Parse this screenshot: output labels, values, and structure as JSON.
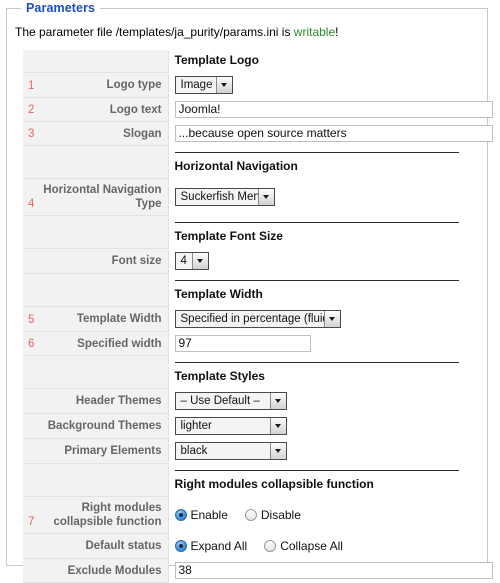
{
  "panel": {
    "legend": "Parameters",
    "intro_prefix": "The parameter file /templates/ja_purity/params.ini is ",
    "intro_status": "writable",
    "intro_suffix": "!",
    "status_color": "#2e8b30",
    "legend_color": "#1a4fc4",
    "number_color": "#e2695a"
  },
  "sections": {
    "logo": "Template Logo",
    "horizontal_nav": "Horizontal Navigation",
    "font_size": "Template Font Size",
    "template_width": "Template Width",
    "template_styles": "Template Styles",
    "right_modules": "Right modules collapsible function"
  },
  "rows": {
    "logo_type": {
      "num": "1",
      "label": "Logo type",
      "value": "Image"
    },
    "logo_text": {
      "num": "2",
      "label": "Logo text",
      "value": "Joomla!"
    },
    "slogan": {
      "num": "3",
      "label": "Slogan",
      "value": "...because open source matters"
    },
    "horizontal_nav_type": {
      "num": "4",
      "label": "Horizontal Navigation Type",
      "value": "Suckerfish Menu"
    },
    "font_size": {
      "num": "",
      "label": "Font size",
      "value": "4"
    },
    "template_width": {
      "num": "5",
      "label": "Template Width",
      "value": "Specified in percentage (fluid)"
    },
    "specified_width": {
      "num": "6",
      "label": "Specified width",
      "value": "97"
    },
    "header_themes": {
      "num": "",
      "label": "Header Themes",
      "value": "– Use Default –"
    },
    "background_themes": {
      "num": "",
      "label": "Background Themes",
      "value": "lighter"
    },
    "primary_elements": {
      "num": "",
      "label": "Primary Elements",
      "value": "black"
    },
    "right_modules_collapsible": {
      "num": "7",
      "label": "Right modules collapsible function",
      "options": [
        "Enable",
        "Disable"
      ],
      "selected": "Enable"
    },
    "default_status": {
      "num": "",
      "label": "Default status",
      "options": [
        "Expand All",
        "Collapse All"
      ],
      "selected": "Expand All"
    },
    "exclude_modules": {
      "num": "",
      "label": "Exclude Modules",
      "value": "38"
    }
  }
}
